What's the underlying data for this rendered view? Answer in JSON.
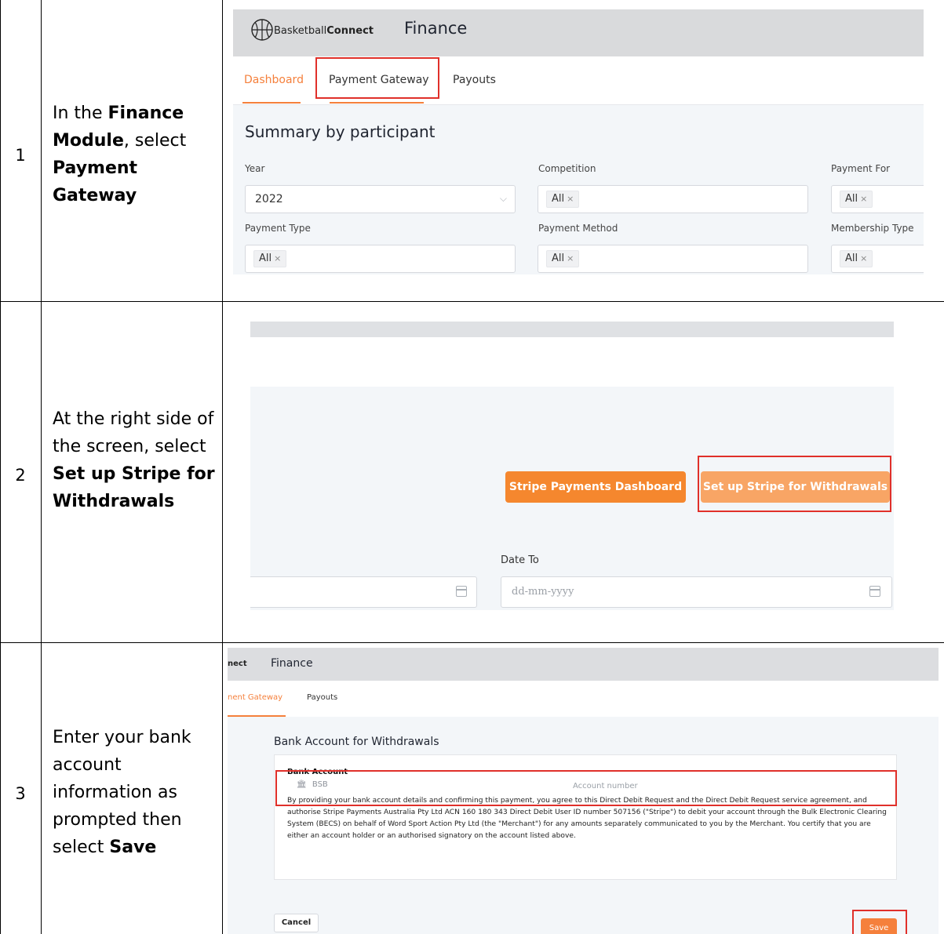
{
  "steps": [
    {
      "number": "1",
      "pre": "In the ",
      "b1": "Finance Module",
      "mid": ", select ",
      "b2": "Payment Gateway"
    },
    {
      "number": "2",
      "pre": "At the right side of the screen, select ",
      "b1": "Set up Stripe for Withdrawals"
    },
    {
      "number": "3",
      "pre": "Enter your bank account information as prompted then select ",
      "b1": "Save"
    }
  ],
  "shot1": {
    "brand_regular": "Basketball",
    "brand_bold": "Connect",
    "title": "Finance",
    "tabs": [
      "Dashboard",
      "Payment Gateway",
      "Payouts"
    ],
    "summary_title": "Summary by participant",
    "filters": {
      "year_label": "Year",
      "year_value": "2022",
      "competition_label": "Competition",
      "competition_value": "All",
      "payment_for_label": "Payment For",
      "payment_for_value": "All",
      "payment_type_label": "Payment Type",
      "payment_type_value": "All",
      "payment_method_label": "Payment Method",
      "payment_method_value": "All",
      "membership_type_label": "Membership Type",
      "membership_type_value": "All"
    },
    "tag_close": "×",
    "chevron": "⌵"
  },
  "shot2": {
    "btn_dashboard": "Stripe Payments Dashboard",
    "btn_setup": "Set up Stripe for Withdrawals",
    "date_to_label": "Date To",
    "date_placeholder": "dd-mm-yyyy"
  },
  "shot3": {
    "brand_fragment": "nect",
    "title": "Finance",
    "tab_active": "nent Gateway",
    "tab_payouts": "Payouts",
    "heading": "Bank Account for Withdrawals",
    "bank_account_label": "Bank Account",
    "bank_icon": "🏛",
    "bsb_placeholder": "BSB",
    "account_placeholder": "Account number",
    "disclaimer": "By providing your bank account details and confirming this payment, you agree to this Direct Debit Request and the Direct Debit Request service agreement, and authorise Stripe Payments Australia Pty Ltd ACN 160 180 343 Direct Debit User ID number 507156 (\"Stripe\") to debit your account through the Bulk Electronic Clearing System (BECS) on behalf of Word Sport Action Pty Ltd (the \"Merchant\") for any amounts separately communicated to you by the Merchant. You certify that you are either an account holder or an authorised signatory on the account listed above.",
    "cancel_label": "Cancel",
    "save_label": "Save"
  },
  "colors": {
    "accent": "#f5803c",
    "highlight_box": "#e0302a",
    "header_bg": "#d9dadc",
    "panel_bg": "#f3f6f9"
  }
}
